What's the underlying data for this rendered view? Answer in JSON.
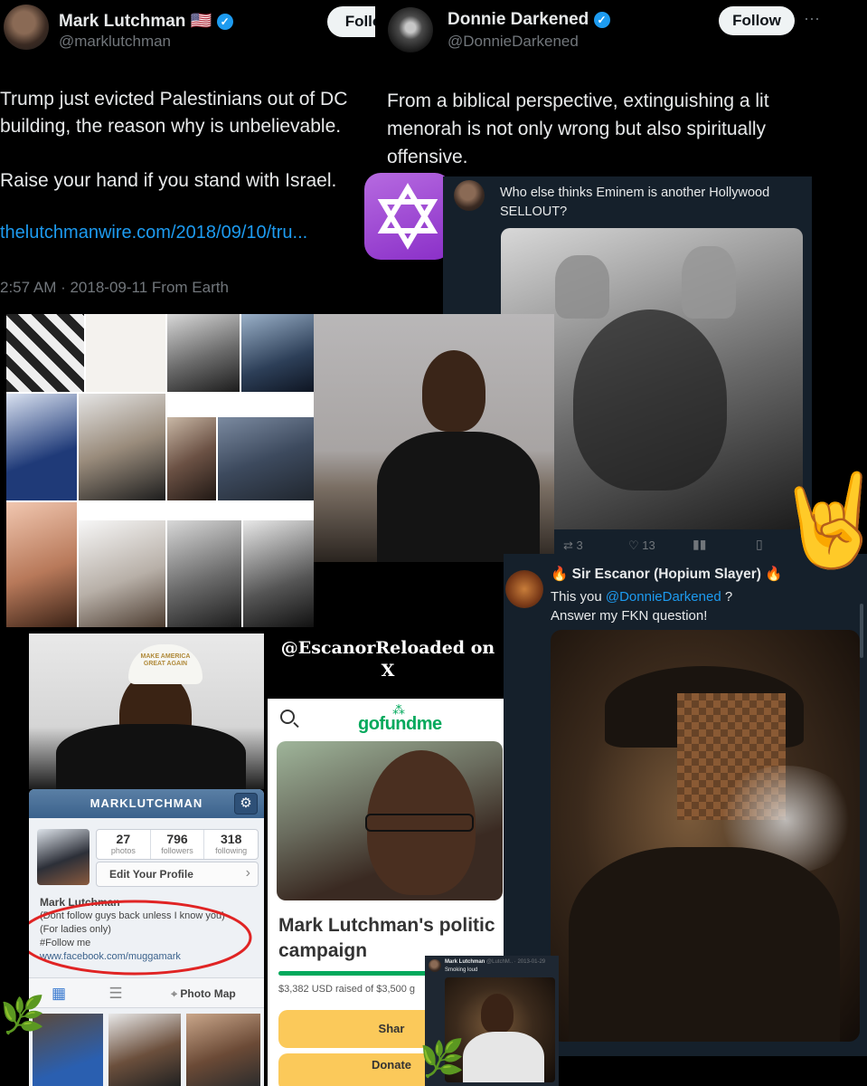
{
  "tweet1": {
    "display_name": "Mark Lutchman",
    "flag": "🇺🇸",
    "handle": "@marklutchman",
    "follow_label": "Follo",
    "line1": "Trump just evicted Palestinians out of DC",
    "line2": "building, the reason why is unbelievable.",
    "line3": "Raise your hand if you stand with Israel.",
    "link": "thelutchmanwire.com/2018/09/10/tru...",
    "meta": "2:57 AM · 2018-09-11 From Earth"
  },
  "tweet2": {
    "display_name": "Donnie Darkened",
    "handle": "@DonnieDarkened",
    "follow_label": "Follow",
    "more_icon": "···",
    "line1": "From a biblical perspective, extinguishing a lit",
    "line2": "menorah is not only wrong but also spiritually",
    "line3": "offensive."
  },
  "star_emoji": "✡️",
  "tweet3": {
    "text_line1": "Who else thinks Eminem is another Hollywood",
    "text_line2": "SELLOUT?",
    "retweets": "3",
    "likes": "13"
  },
  "horns_emoji": "🤘",
  "tweet4": {
    "name_prefix": "🔥",
    "display_name": "Sir Escanor (Hopium Slayer)",
    "name_suffix": "🔥",
    "line1_prefix": "This you ",
    "mention": "@DonnieDarkened",
    "line1_suffix": " ?",
    "line2": "Answer my FKN question!"
  },
  "watermark": {
    "line1": "@EscanorReloaded on",
    "line2": "X"
  },
  "cap_text": "MAKE AMERICA GREAT AGAIN",
  "instagram": {
    "username": "MARKLUTCHMAN",
    "photos_count": "27",
    "photos_label": "photos",
    "followers_count": "796",
    "followers_label": "followers",
    "following_count": "318",
    "following_label": "following",
    "edit_profile": "Edit Your Profile",
    "bio_name": "Mark Lutchman",
    "bio_line1": "(Dont follow guys back unless I know you)",
    "bio_line2": "(For ladies only)",
    "bio_line3": "#Follow me",
    "bio_link": "www.facebook.com/muggamark",
    "photo_map": "Photo Map"
  },
  "gofundme": {
    "logo": "gofundme",
    "title_line1": "Mark Lutchman's politic",
    "title_line2": "campaign",
    "raised": "$3,382 USD raised of $3,500 g",
    "progress": 0.966,
    "share_label": "Shar",
    "donate_label": "Donate"
  },
  "mini_tweet": {
    "name": "Mark Lutchman",
    "handle_date": "@LutchM.. · 2013-01-29",
    "text": "Smoking loud"
  },
  "herb_emoji": "🌿",
  "colors": {
    "x_blue": "#1d9bf0",
    "x_text": "#e7e9ea",
    "x_muted": "#71767b",
    "x_dark_bg": "#15202b",
    "ig_blue": "#3b628c",
    "gfm_green": "#02a95c",
    "gfm_yellow": "#fbc95a",
    "annotation_red": "#e02424"
  }
}
